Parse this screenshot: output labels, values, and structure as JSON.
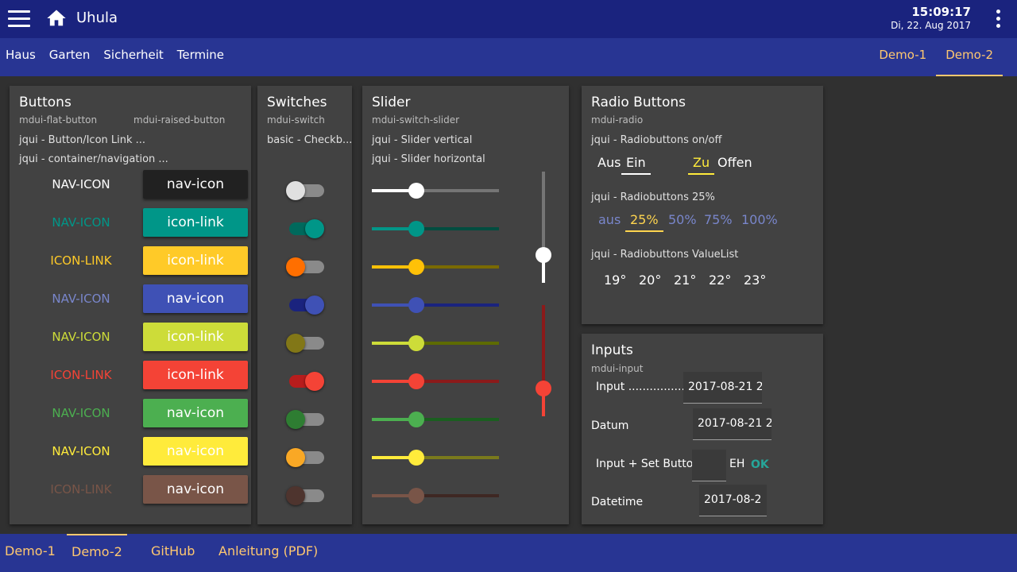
{
  "app": {
    "title": "Uhula",
    "time": "15:09:17",
    "date": "Di, 22. Aug 2017"
  },
  "icons": {
    "menu": "hamburger-icon",
    "home": "home-icon",
    "more": "more-vert-icon"
  },
  "nav": {
    "left": [
      "Haus",
      "Garten",
      "Sicherheit",
      "Termine"
    ],
    "right": [
      {
        "label": "Demo-1",
        "active": false
      },
      {
        "label": "Demo-2",
        "active": true
      }
    ]
  },
  "buttons_card": {
    "title": "Buttons",
    "sub_flat": "mdui-flat-button",
    "sub_raised": "mdui-raised-button",
    "line1": "jqui - Button/Icon Link ...",
    "line2": "jqui - container/navigation ...",
    "rows": [
      {
        "flat": "NAV-ICON",
        "raised": "nav-icon",
        "color": "#212121",
        "flat_color": "#ffffff",
        "text_color": "#ffffff"
      },
      {
        "flat": "NAV-ICON",
        "raised": "icon-link",
        "color": "#009688",
        "flat_color": "#009688",
        "text_color": "#ffffff"
      },
      {
        "flat": "ICON-LINK",
        "raised": "icon-link",
        "color": "#ffca28",
        "flat_color": "#ffca28",
        "text_color": "#ffffff"
      },
      {
        "flat": "NAV-ICON",
        "raised": "nav-icon",
        "color": "#3f51b5",
        "flat_color": "#7986cb",
        "text_color": "#ffffff"
      },
      {
        "flat": "NAV-ICON",
        "raised": "icon-link",
        "color": "#cddc39",
        "flat_color": "#cddc39",
        "text_color": "#ffffff"
      },
      {
        "flat": "ICON-LINK",
        "raised": "icon-link",
        "color": "#f44336",
        "flat_color": "#f44336",
        "text_color": "#ffffff"
      },
      {
        "flat": "NAV-ICON",
        "raised": "nav-icon",
        "color": "#4caf50",
        "flat_color": "#4caf50",
        "text_color": "#ffffff"
      },
      {
        "flat": "NAV-ICON",
        "raised": "nav-icon",
        "color": "#ffeb3b",
        "flat_color": "#ffeb3b",
        "text_color": "#ffffff"
      },
      {
        "flat": "ICON-LINK",
        "raised": "nav-icon",
        "color": "#795548",
        "flat_color": "#795548",
        "text_color": "#ffffff"
      }
    ]
  },
  "switches_card": {
    "title": "Switches",
    "sub": "mdui-switch",
    "line1": "basic - Checkb...",
    "items": [
      {
        "on": false,
        "thumb": "#e0e0e0",
        "track": "#8a8a8a"
      },
      {
        "on": true,
        "thumb": "#009688",
        "track": "#00695c"
      },
      {
        "on": false,
        "thumb": "#ff6f00",
        "track": "#8a8a8a"
      },
      {
        "on": true,
        "thumb": "#3f51b5",
        "track": "#1a237e"
      },
      {
        "on": false,
        "thumb": "#827717",
        "track": "#8a8a8a"
      },
      {
        "on": true,
        "thumb": "#f44336",
        "track": "#b71c1c"
      },
      {
        "on": false,
        "thumb": "#2e7d32",
        "track": "#8a8a8a"
      },
      {
        "on": false,
        "thumb": "#f9a825",
        "track": "#8a8a8a"
      },
      {
        "on": false,
        "thumb": "#4e342e",
        "track": "#8a8a8a"
      }
    ]
  },
  "slider_card": {
    "title": "Slider",
    "sub": "mdui-switch-slider",
    "line1": "jqui - Slider vertical",
    "line2": "jqui - Slider horizontal",
    "horizontal": [
      {
        "value": 0.35,
        "thumb": "#ffffff",
        "fill": "#ffffff",
        "track": "#757575"
      },
      {
        "value": 0.35,
        "thumb": "#009688",
        "fill": "#009688",
        "track": "#004d40"
      },
      {
        "value": 0.35,
        "thumb": "#ffc107",
        "fill": "#ffc107",
        "track": "#7a6a00"
      },
      {
        "value": 0.35,
        "thumb": "#3f51b5",
        "fill": "#3f51b5",
        "track": "#1a237e"
      },
      {
        "value": 0.35,
        "thumb": "#cddc39",
        "fill": "#cddc39",
        "track": "#5d6b00"
      },
      {
        "value": 0.35,
        "thumb": "#f44336",
        "fill": "#f44336",
        "track": "#8b1a1a"
      },
      {
        "value": 0.35,
        "thumb": "#4caf50",
        "fill": "#4caf50",
        "track": "#1b5e20"
      },
      {
        "value": 0.35,
        "thumb": "#ffeb3b",
        "fill": "#ffeb3b",
        "track": "#7a7a1c"
      },
      {
        "value": 0.35,
        "thumb": "#795548",
        "fill": "#795548",
        "track": "#3e2723"
      }
    ],
    "vertical": [
      {
        "value": 0.25,
        "thumb": "#ffffff",
        "fill": "#ffffff",
        "track": "#757575"
      },
      {
        "value": 0.25,
        "thumb": "#f44336",
        "fill": "#f44336",
        "track": "#8b1a1a"
      }
    ]
  },
  "radio_card": {
    "title": "Radio Buttons",
    "sub": "mdui-radio",
    "line1": "jqui - Radiobuttons on/off",
    "onoff1": [
      "Aus",
      "Ein"
    ],
    "onoff2": [
      "Zu",
      "Offen"
    ],
    "line2": "jqui - Radiobuttons 25%",
    "pct": [
      "aus",
      "25%",
      "50%",
      "75%",
      "100%"
    ],
    "line3": "jqui - Radiobuttons ValueList",
    "temps": [
      "19°",
      "20°",
      "21°",
      "22°",
      "23°"
    ]
  },
  "inputs_card": {
    "title": "Inputs",
    "sub": "mdui-input",
    "input_label": "Input .................",
    "input_value": "2017-08-21 2",
    "datum_label": "Datum",
    "datum_value": "2017-08-21 2",
    "setbtn_label": "Input + Set Button",
    "setbtn_unit": "EH",
    "setbtn_ok": "OK",
    "datetime_label": "Datetime",
    "datetime_value": "2017-08-2"
  },
  "bottom": [
    {
      "label": "Demo-1",
      "active": false
    },
    {
      "label": "Demo-2",
      "active": true
    },
    {
      "label": "GitHub",
      "active": false
    },
    {
      "label": "Anleitung (PDF)",
      "active": false
    }
  ]
}
